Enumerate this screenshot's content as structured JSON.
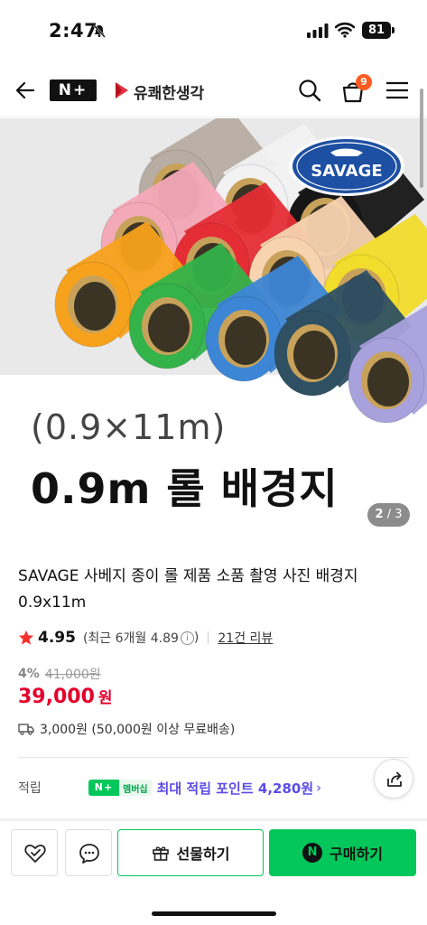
{
  "status_bar": {
    "time": "2:47",
    "battery": "81",
    "icons": [
      "bell-muted-icon",
      "cellular-signal-icon",
      "wifi-icon",
      "battery-icon"
    ]
  },
  "header": {
    "np_logo": "N+",
    "store_name": "유쾌한생각",
    "cart_count": "9",
    "icons": [
      "back-arrow-icon",
      "search-icon",
      "cart-icon",
      "menu-icon"
    ]
  },
  "hero": {
    "brand_logo": "SAVAGE",
    "subtitle": "(0.9×11m)",
    "headline": "0.9m 롤 배경지",
    "pager_current": "2",
    "pager_total": "/ 3",
    "roll_colors": [
      "#b7ada3",
      "#f2f2f2",
      "#161616",
      "#f4a9b9",
      "#e52d35",
      "#f7d3b0",
      "#f2dc2c",
      "#f7a21c",
      "#33b34a",
      "#3d86d6",
      "#2f5063",
      "#a9a1dc"
    ]
  },
  "product": {
    "title": "SAVAGE 사베지 종이 롤 제품 소품 촬영 사진 배경지 0.9x11m",
    "rating": "4.95",
    "recent_rating": "(최근 6개월 4.89",
    "info_glyph": "i",
    "recent_close": ")",
    "reviews": "21건 리뷰",
    "discount_pct": "4%",
    "original_price": "41,000원",
    "price": "39,000",
    "currency": "원",
    "shipping": "3,000원 (50,000원 이상 무료배송)"
  },
  "points": {
    "label": "적립",
    "badge_np": "N+",
    "badge_member": "멤버십",
    "text": "최대 적립 포인트 4,280원",
    "chevron": "›"
  },
  "bottom_bar": {
    "gift_label": "선물하기",
    "buy_n": "N",
    "buy_label": "구매하기"
  },
  "colors": {
    "naver_green": "#03c75a",
    "price_red": "#e4002b",
    "points_purple": "#5b4ce6",
    "cart_badge": "#ff5a1f"
  }
}
